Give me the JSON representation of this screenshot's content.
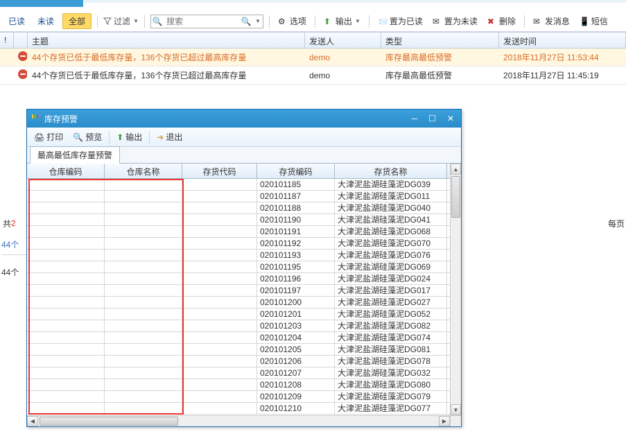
{
  "toolbar": {
    "read": "已读",
    "unread": "未读",
    "all": "全部",
    "filter": "过滤",
    "search_placeholder": "搜索",
    "options": "选项",
    "export": "输出",
    "mark_read": "置为已读",
    "mark_unread": "置为未读",
    "delete": "删除",
    "send_msg": "发消息",
    "sms": "短信"
  },
  "main_header": {
    "subject": "主题",
    "sender": "发送人",
    "type": "类型",
    "time": "发送时间"
  },
  "rows": [
    {
      "subject": "44个存货已低于最低库存量，136个存货已超过最高库存量",
      "sender": "demo",
      "type": "库存最高最低预警",
      "time": "2018年11月27日 11:53:44",
      "selected": true
    },
    {
      "subject": "44个存货已低于最低库存量，136个存货已超过最高库存量",
      "sender": "demo",
      "type": "库存最高最低预警",
      "time": "2018年11月27日 11:45:19",
      "selected": false
    }
  ],
  "footer": {
    "prefix": "共 ",
    "count": "2",
    "per_page": "每页"
  },
  "preview": {
    "line1": "44个",
    "line2": "44个"
  },
  "modal": {
    "title": "库存预警",
    "btn_print": "打印",
    "btn_preview": "预览",
    "btn_export": "输出",
    "btn_exit": "退出",
    "tab": "最高最低库存量预警",
    "columns": {
      "c1": "仓库编码",
      "c2": "仓库名称",
      "c3": "存货代码",
      "c4": "存货编码",
      "c5": "存货名称"
    },
    "rows": [
      {
        "c4": "020101185",
        "c5": "大津泥盐湖硅藻泥DG039"
      },
      {
        "c4": "020101187",
        "c5": "大津泥盐湖硅藻泥DG011"
      },
      {
        "c4": "020101188",
        "c5": "大津泥盐湖硅藻泥DG040"
      },
      {
        "c4": "020101190",
        "c5": "大津泥盐湖硅藻泥DG041"
      },
      {
        "c4": "020101191",
        "c5": "大津泥盐湖硅藻泥DG068"
      },
      {
        "c4": "020101192",
        "c5": "大津泥盐湖硅藻泥DG070"
      },
      {
        "c4": "020101193",
        "c5": "大津泥盐湖硅藻泥DG076"
      },
      {
        "c4": "020101195",
        "c5": "大津泥盐湖硅藻泥DG069"
      },
      {
        "c4": "020101196",
        "c5": "大津泥盐湖硅藻泥DG024"
      },
      {
        "c4": "020101197",
        "c5": "大津泥盐湖硅藻泥DG017"
      },
      {
        "c4": "020101200",
        "c5": "大津泥盐湖硅藻泥DG027"
      },
      {
        "c4": "020101201",
        "c5": "大津泥盐湖硅藻泥DG052"
      },
      {
        "c4": "020101203",
        "c5": "大津泥盐湖硅藻泥DG082"
      },
      {
        "c4": "020101204",
        "c5": "大津泥盐湖硅藻泥DG074"
      },
      {
        "c4": "020101205",
        "c5": "大津泥盐湖硅藻泥DG081"
      },
      {
        "c4": "020101206",
        "c5": "大津泥盐湖硅藻泥DG078"
      },
      {
        "c4": "020101207",
        "c5": "大津泥盐湖硅藻泥DG032"
      },
      {
        "c4": "020101208",
        "c5": "大津泥盐湖硅藻泥DG080"
      },
      {
        "c4": "020101209",
        "c5": "大津泥盐湖硅藻泥DG079"
      },
      {
        "c4": "020101210",
        "c5": "大津泥盐湖硅藻泥DG077"
      }
    ]
  }
}
